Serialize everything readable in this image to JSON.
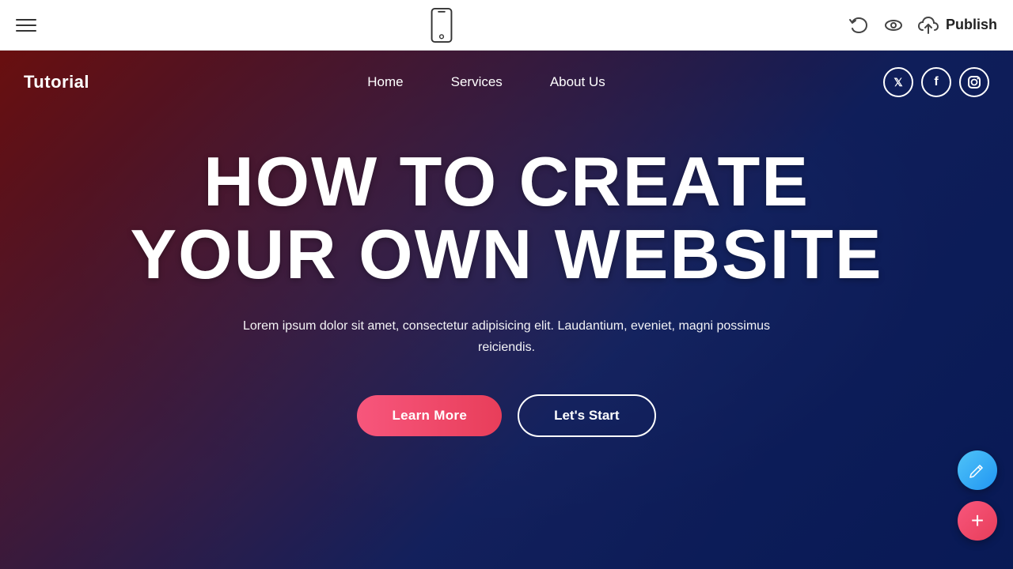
{
  "toolbar": {
    "hamburger_label": "menu",
    "undo_label": "undo",
    "preview_label": "preview",
    "publish_label": "Publish",
    "phone_label": "mobile-preview"
  },
  "site": {
    "logo": "Tutorial",
    "nav": {
      "links": [
        {
          "label": "Home",
          "id": "home"
        },
        {
          "label": "Services",
          "id": "services"
        },
        {
          "label": "About Us",
          "id": "about"
        }
      ],
      "socials": [
        {
          "label": "Twitter",
          "icon": "𝕏",
          "id": "twitter"
        },
        {
          "label": "Facebook",
          "icon": "f",
          "id": "facebook"
        },
        {
          "label": "Instagram",
          "icon": "◎",
          "id": "instagram"
        }
      ]
    },
    "hero": {
      "title_line1": "HOW TO CREATE",
      "title_line2": "YOUR OWN WEBSITE",
      "subtitle": "Lorem ipsum dolor sit amet, consectetur adipisicing elit. Laudantium, eveniet, magni possimus reiciendis.",
      "btn_learn_more": "Learn More",
      "btn_lets_start": "Let's Start"
    }
  },
  "fab": {
    "pencil_label": "edit",
    "add_label": "add"
  },
  "colors": {
    "accent_red": "#f7567c",
    "accent_blue": "#2196f3",
    "overlay_red": "rgba(140,20,20,0.75)",
    "overlay_blue": "rgba(20,40,120,0.75)"
  }
}
